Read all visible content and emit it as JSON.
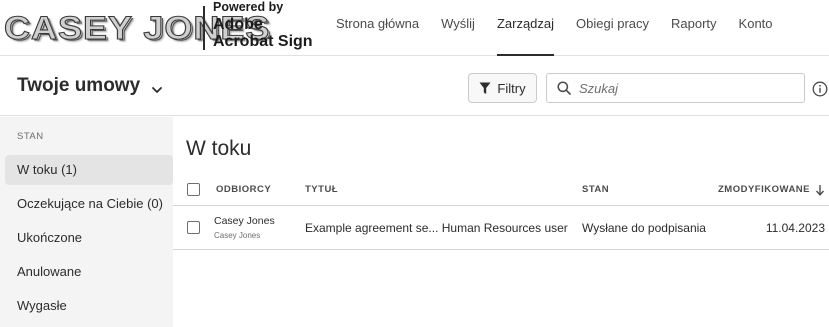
{
  "logo": {
    "text": "CASEY JONES"
  },
  "brand": {
    "powered": "Powered by",
    "adobe": "Adobe",
    "acrobat": "Acrobat Sign"
  },
  "nav": {
    "items": [
      {
        "label": "Strona główna"
      },
      {
        "label": "Wyślij"
      },
      {
        "label": "Zarządzaj"
      },
      {
        "label": "Obiegi pracy"
      },
      {
        "label": "Raporty"
      },
      {
        "label": "Konto"
      }
    ],
    "active": "Zarządzaj"
  },
  "subheader": {
    "title": "Twoje umowy",
    "filter_label": "Filtry",
    "search_placeholder": "Szukaj"
  },
  "sidebar": {
    "heading": "STAN",
    "items": [
      {
        "label": "W toku (1)"
      },
      {
        "label": "Oczekujące na Ciebie (0)"
      },
      {
        "label": "Ukończone"
      },
      {
        "label": "Anulowane"
      },
      {
        "label": "Wygasłe"
      }
    ],
    "active": "W toku (1)"
  },
  "main": {
    "title": "W toku",
    "columns": {
      "recipients": "ODBIORCY",
      "title": "TYTUŁ",
      "status": "STAN",
      "modified": "ZMODYFIKOWANE"
    },
    "rows": [
      {
        "recipient_name": "Casey Jones",
        "recipient_sub": "Casey Jones",
        "title": "Example agreement se... Human Resources user",
        "status": "Wysłane do podpisania",
        "modified": "11.04.2023"
      }
    ]
  },
  "colors": {
    "accent": "#2c2c2c",
    "sidebar_bg": "#f4f4f4",
    "active_item_bg": "#e4e4e4"
  }
}
